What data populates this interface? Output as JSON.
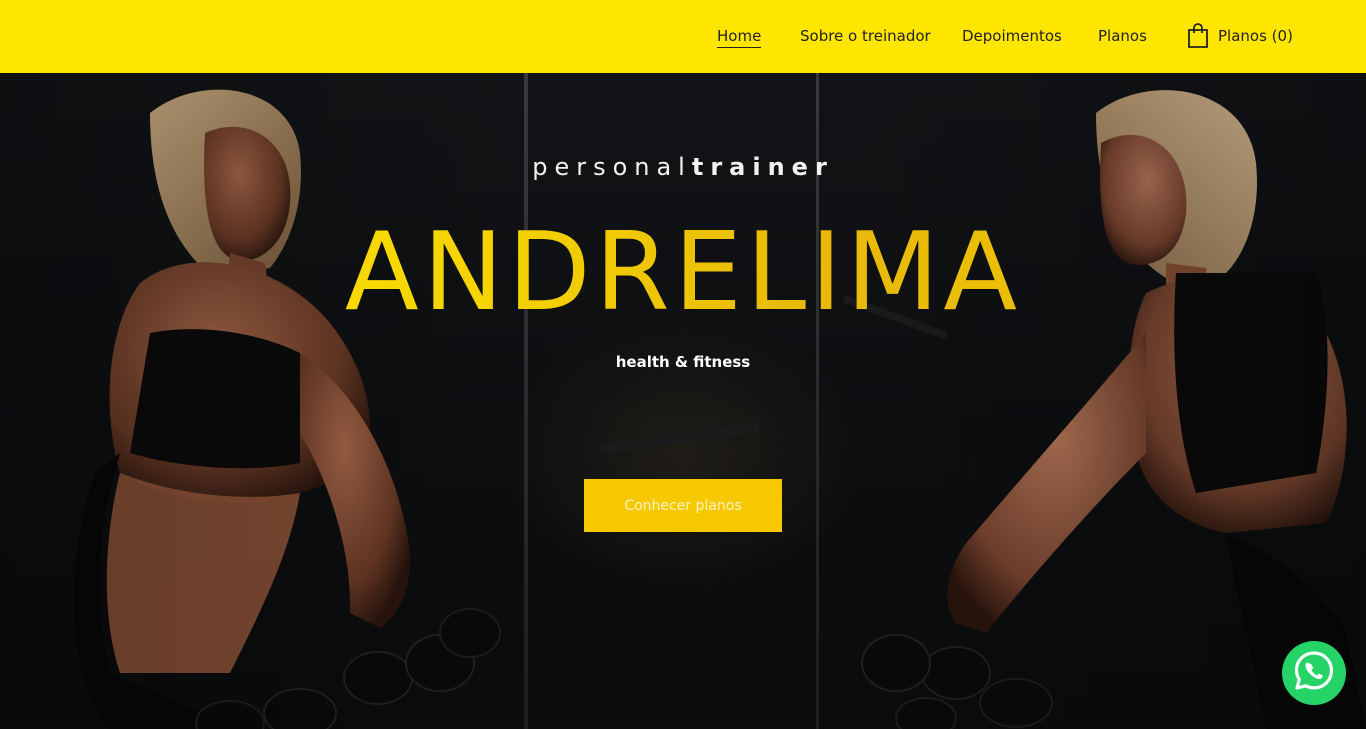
{
  "nav": {
    "items": [
      {
        "label": "Home",
        "active": true
      },
      {
        "label": "Sobre o treinador",
        "active": false
      },
      {
        "label": "Depoimentos",
        "active": false
      },
      {
        "label": "Planos",
        "active": false
      }
    ],
    "cart": {
      "label": "Planos (0)",
      "icon": "shopping-bag-icon"
    }
  },
  "hero": {
    "subtitle_light": "personal",
    "subtitle_bold": "trainer",
    "title": "ANDRELIMA",
    "tagline": "health & fitness",
    "cta_label": "Conhecer planos"
  },
  "floating": {
    "whatsapp_icon": "whatsapp-icon"
  },
  "colors": {
    "header_bg": "#ffe600",
    "accent": "#f5c800",
    "whatsapp": "#25d366"
  }
}
